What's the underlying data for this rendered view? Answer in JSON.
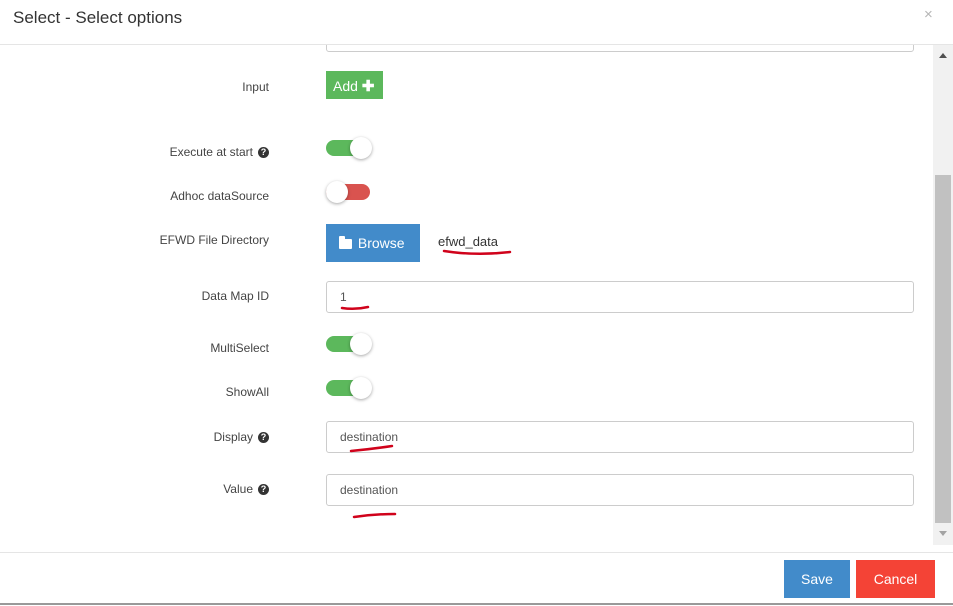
{
  "dialog": {
    "title": "Select - Select options",
    "close_symbol": "×"
  },
  "form": {
    "top_field_value": "",
    "input": {
      "label": "Input",
      "add_label": "Add",
      "add_icon": "plus-icon"
    },
    "execute_at_start": {
      "label": "Execute at start",
      "on": true
    },
    "adhoc_datasource": {
      "label": "Adhoc dataSource",
      "on": false
    },
    "efwd_file_directory": {
      "label": "EFWD File Directory",
      "browse_label": "Browse",
      "browse_icon": "folder-icon",
      "value": "efwd_data"
    },
    "data_map_id": {
      "label": "Data Map ID",
      "value": "1"
    },
    "multiselect": {
      "label": "MultiSelect",
      "on": true
    },
    "showall": {
      "label": "ShowAll",
      "on": true
    },
    "display": {
      "label": "Display",
      "value": "destination"
    },
    "value": {
      "label": "Value",
      "value": "destination"
    }
  },
  "footer": {
    "save_label": "Save",
    "cancel_label": "Cancel"
  },
  "colors": {
    "toggle_on": "#5cb85c",
    "toggle_off": "#d9534f",
    "primary": "#428bca",
    "danger": "#f44336",
    "annotation": "#d0021b"
  }
}
